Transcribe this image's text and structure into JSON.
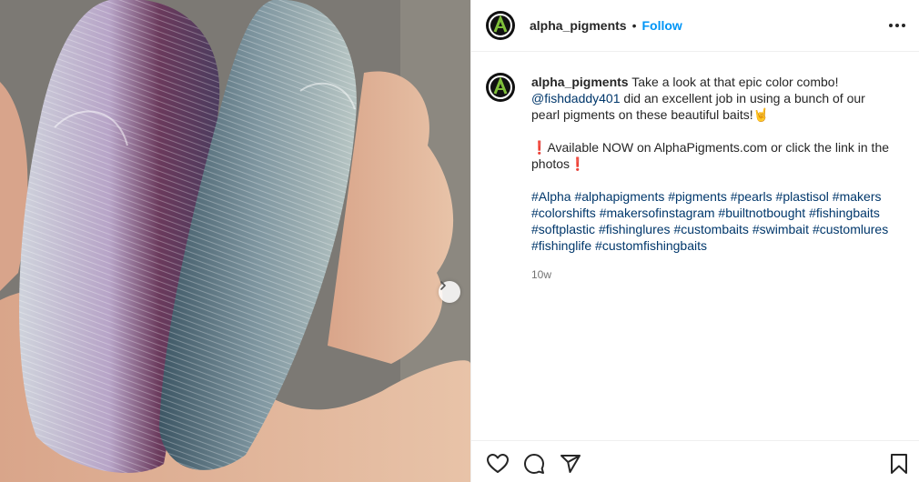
{
  "post": {
    "username": "alpha_pigments",
    "separator": "•",
    "follow_label": "Follow",
    "caption": {
      "username": "alpha_pigments",
      "line1": "Take a look at that epic color combo!",
      "mention": "@fishdaddy401",
      "line2": " did an excellent job in using a bunch of our pearl pigments on these beautiful baits!",
      "emoji_horns": "🤘",
      "exclaim": "❗",
      "line3": "Available NOW on AlphaPigments.com or click the link in the photos",
      "hashtags": [
        "#Alpha",
        "#alphapigments",
        "#pigments",
        "#pearls",
        "#plastisol",
        "#makers",
        "#colorshifts",
        "#makersofinstagram",
        "#builtnotbought",
        "#fishingbaits",
        "#softplastic",
        "#fishinglures",
        "#custombaits",
        "#swimbait",
        "#customlures",
        "#fishinglife",
        "#customfishingbaits"
      ]
    },
    "timestamp": "10w"
  },
  "icons": {
    "more": "more-horizontal-icon",
    "like": "heart-icon",
    "comment": "comment-icon",
    "share": "send-icon",
    "save": "bookmark-icon",
    "next": "chevron-right-icon"
  },
  "colors": {
    "link_blue": "#0095f6",
    "hashtag": "#00376b",
    "muted": "#737373",
    "text": "#262626"
  }
}
